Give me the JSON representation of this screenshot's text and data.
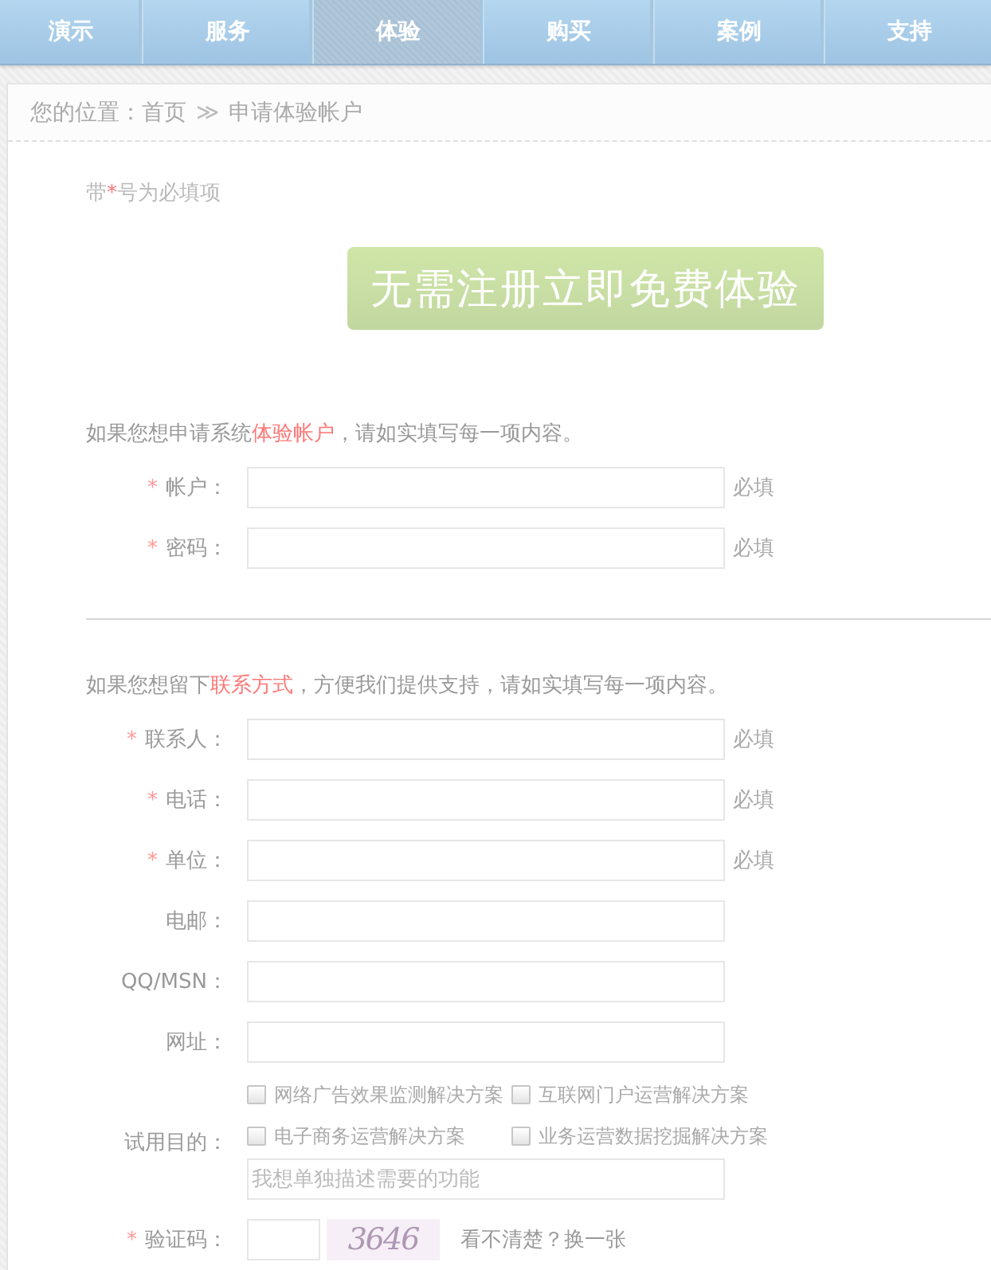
{
  "nav": {
    "items": [
      {
        "label": "演示",
        "selected": false
      },
      {
        "label": "服务",
        "selected": false
      },
      {
        "label": "体验",
        "selected": true
      },
      {
        "label": "购买",
        "selected": false
      },
      {
        "label": "案例",
        "selected": false
      },
      {
        "label": "支持",
        "selected": false
      }
    ]
  },
  "breadcrumb": {
    "prefix": "您的位置：",
    "items": [
      "首页",
      "申请体验帐户"
    ],
    "separator": "≫"
  },
  "required_notice": [
    {
      "text": "带",
      "kind": "plain"
    },
    {
      "text": "*",
      "kind": "highlight"
    },
    {
      "text": "号为必填项",
      "kind": "plain"
    }
  ],
  "banner": {
    "label": "无需注册立即免费体验"
  },
  "sections": [
    {
      "intro": [
        {
          "text": "如果您想申请系统",
          "kind": "plain"
        },
        {
          "text": "体验帐户",
          "kind": "highlight"
        },
        {
          "text": "，请如实填写每一项内容。",
          "kind": "plain"
        }
      ],
      "rows": [
        {
          "mark": "*",
          "label": "帐户：",
          "note": "必填"
        },
        {
          "mark": "*",
          "label": "密码：",
          "note": "必填"
        }
      ]
    },
    {
      "intro": [
        {
          "text": "如果您想留下",
          "kind": "plain"
        },
        {
          "text": "联系方式",
          "kind": "highlight"
        },
        {
          "text": "，方便我们提供支持，请如实填写每一项内容。",
          "kind": "plain"
        }
      ],
      "rows": [
        {
          "mark": "*",
          "label": "联系人：",
          "note": "必填"
        },
        {
          "mark": "*",
          "label": "电话：",
          "note": "必填"
        },
        {
          "mark": "*",
          "label": "单位：",
          "note": "必填"
        },
        {
          "label": "电邮："
        },
        {
          "label": "QQ/MSN："
        },
        {
          "label": "网址："
        }
      ]
    }
  ],
  "purpose": {
    "label": "试用目的：",
    "options": [
      {
        "label": "网络广告效果监测解决方案",
        "checked": false
      },
      {
        "label": "互联网门户运营解决方案",
        "checked": false
      },
      {
        "label": "电子商务运营解决方案",
        "checked": false
      },
      {
        "label": "业务运营数据挖掘解决方案",
        "checked": false
      }
    ],
    "detail": {
      "placeholder": "我想单独描述需要的功能"
    }
  },
  "captcha": {
    "mark": "*",
    "label": "验证码：",
    "code": "3646",
    "refresh": "看不清楚？换一张"
  }
}
